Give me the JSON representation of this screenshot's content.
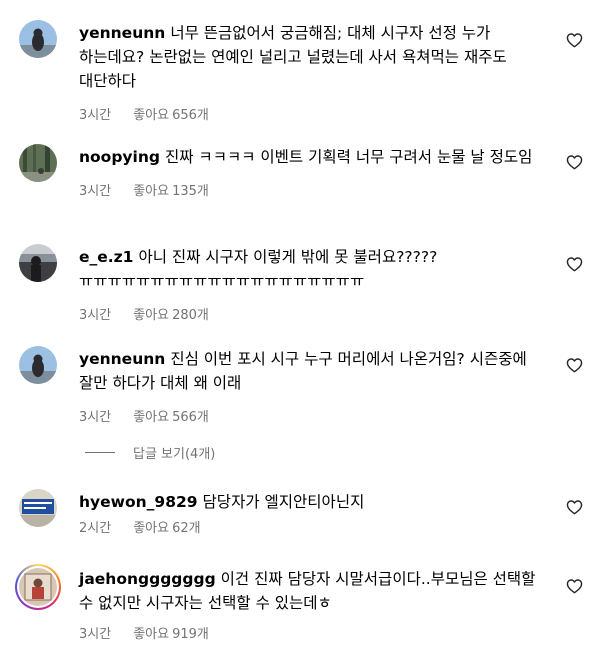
{
  "like_label": "좋아요",
  "view_replies": "답글 보기(4개)",
  "comments": [
    {
      "username": "yenneunn",
      "text": "너무 뜬금없어서 궁금해짐; 대체 시구자 선정 누가 하는데요? 논란없는 연예인 널리고 널렸는데 사서 욕쳐먹는 재주도 대단하다",
      "time": "3시간",
      "likes": "656개"
    },
    {
      "username": "noopying",
      "text": "진짜 ㅋㅋㅋㅋ 이벤트 기획력 너무 구려서 눈물 날 정도임",
      "time": "3시간",
      "likes": "135개"
    },
    {
      "username": "e_e.z1",
      "text": "아니 진짜 시구자 이렇게 밖에 못 불러요????? ㅠㅠㅠㅠㅠㅠㅠㅠㅠㅠㅠㅠㅠㅠㅠㅠㅠㅠㅠㅠ",
      "time": "3시간",
      "likes": "280개"
    },
    {
      "username": "yenneunn",
      "text": "진심 이번 포시 시구 누구 머리에서 나온거임? 시즌중에 잘만 하다가 대체 왜 이래",
      "time": "3시간",
      "likes": "566개"
    },
    {
      "username": "hyewon_9829",
      "text": "담당자가 엘지안티아닌지",
      "time": "2시간",
      "likes": "62개"
    },
    {
      "username": "jaehonggggggg",
      "text": "이건 진짜 담당자 시말서급이다..부모님은 선택할 수 없지만 시구자는 선택할 수 있는데ㅎ",
      "time": "3시간",
      "likes": "919개"
    }
  ]
}
